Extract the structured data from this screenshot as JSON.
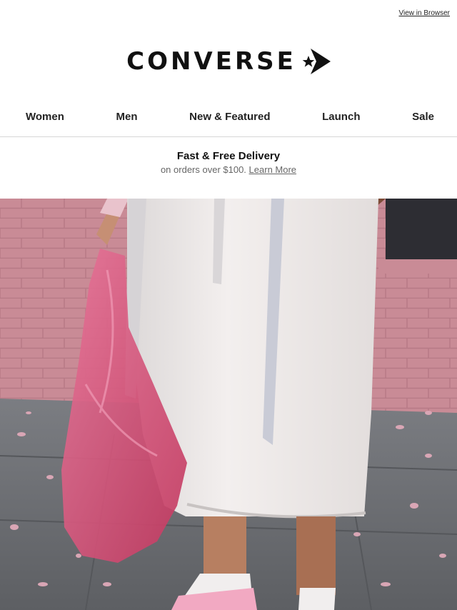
{
  "header": {
    "view_in_browser": "View in Browser",
    "logo_text": "CONVERSE"
  },
  "nav": {
    "items": [
      {
        "label": "Women"
      },
      {
        "label": "Men"
      },
      {
        "label": "New & Featured"
      },
      {
        "label": "Launch"
      },
      {
        "label": "Sale"
      }
    ]
  },
  "promo": {
    "title": "Fast & Free Delivery",
    "subtitle": "on orders over $100.",
    "link": "Learn More"
  },
  "colors": {
    "wall": "#c98b96",
    "bag": "#d2456e",
    "skirt": "#ece7e6",
    "pavement": "#6c6f73"
  }
}
